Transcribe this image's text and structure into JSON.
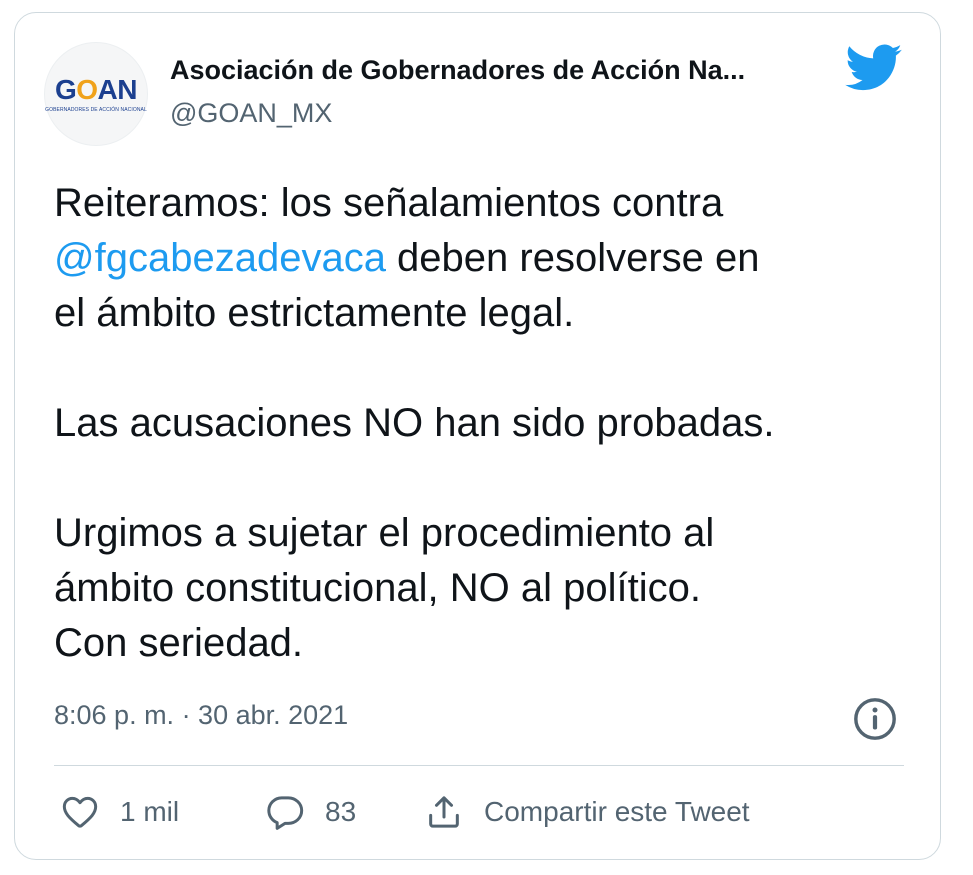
{
  "account": {
    "logo_text_main": "G",
    "logo_text_o": "O",
    "logo_text_rest": "AN",
    "logo_subtext": "GOBERNADORES DE ACCIÓN NACIONAL",
    "name": "Asociación de Gobernadores de Acción Na...",
    "handle": "@GOAN_MX"
  },
  "tweet": {
    "line1_text": "Reiteramos: los señalamientos contra",
    "mention": "@fgcabezadevaca",
    "line2_rest": " deben resolverse en",
    "line3": "el ámbito estrictamente legal.",
    "paragraph2": "Las acusaciones NO han sido probadas.",
    "paragraph3_line1": "Urgimos a sujetar el procedimiento al",
    "paragraph3_line2": "ámbito constitucional, NO al político.",
    "paragraph3_line3": "Con seriedad.",
    "timestamp": "8:06 p. m. · 30 abr. 2021"
  },
  "actions": {
    "like_count": "1 mil",
    "reply_count": "83",
    "share_label": "Compartir este Tweet"
  },
  "icons": {
    "brand": "twitter-bird-icon",
    "info": "info-icon",
    "like": "heart-icon",
    "reply": "speech-bubble-icon",
    "share": "share-icon"
  },
  "colors": {
    "twitter_blue": "#1d9bf0",
    "text": "#0f1419",
    "muted": "#536471",
    "border": "#cfd9de",
    "logo_blue": "#1b3f8f",
    "logo_orange": "#f0a21b"
  }
}
